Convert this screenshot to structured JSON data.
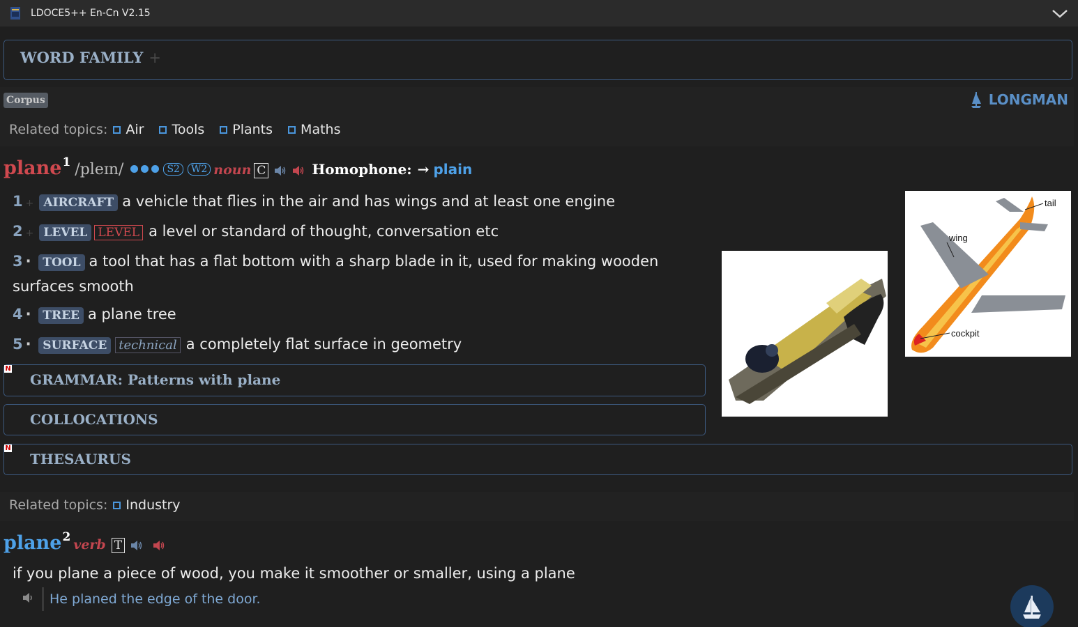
{
  "window": {
    "title": "LDOCE5++ En-Cn V2.15",
    "app_icon": "book-icon",
    "collapse_icon": "chevron-down-icon"
  },
  "word_family": {
    "label": "WORD FAMILY",
    "plus": "+"
  },
  "corpus_label": "Corpus",
  "publisher_logo": "LONGMAN",
  "entry1": {
    "related_label": "Related topics:",
    "topics": [
      "Air",
      "Tools",
      "Plants",
      "Maths"
    ],
    "headword": "plane",
    "homnum": "1",
    "pron": "/pleɪn/",
    "freq_spoken": "S2",
    "freq_written": "W2",
    "pos": "noun",
    "grammar": "C",
    "homophone_label": "Homophone:",
    "homophone_arrow": "→",
    "homophone_word": "plain",
    "senses": [
      {
        "num": "1",
        "mark": "+",
        "signpost": "AIRCRAFT",
        "definition": "a vehicle that flies in the air and has wings and at least one engine"
      },
      {
        "num": "2",
        "mark": "+",
        "signpost": "LEVEL",
        "register": "LEVEL",
        "definition": "a level or standard of thought, conversation etc"
      },
      {
        "num": "3",
        "mark": "·",
        "signpost": "TOOL",
        "definition": "a tool that has a flat bottom with a sharp blade in it, used for making wooden surfaces smooth"
      },
      {
        "num": "4",
        "mark": "·",
        "signpost": "TREE",
        "definition": "a plane tree"
      },
      {
        "num": "5",
        "mark": "·",
        "signpost": "SURFACE",
        "field": "technical",
        "definition": "a completely flat surface in geometry"
      }
    ],
    "sections": [
      {
        "label": "GRAMMAR: Patterns with plane",
        "new_badge": "N"
      },
      {
        "label": "COLLOCATIONS"
      },
      {
        "label": "THESAURUS",
        "new_badge": "N"
      }
    ],
    "aircraft_labels": {
      "tail": "tail",
      "wing": "wing",
      "cockpit": "cockpit"
    }
  },
  "entry2": {
    "related_label": "Related topics:",
    "topics": [
      "Industry"
    ],
    "headword": "plane",
    "homnum": "2",
    "pos": "verb",
    "grammar": "T",
    "definition": "if you plane a piece of wood, you make it smoother or smaller, using a plane",
    "example": "He planed the edge of the door."
  },
  "colors": {
    "accent_blue": "#4ea1e8",
    "headword_red": "#d0494f",
    "border_blue": "#3d5a80"
  }
}
